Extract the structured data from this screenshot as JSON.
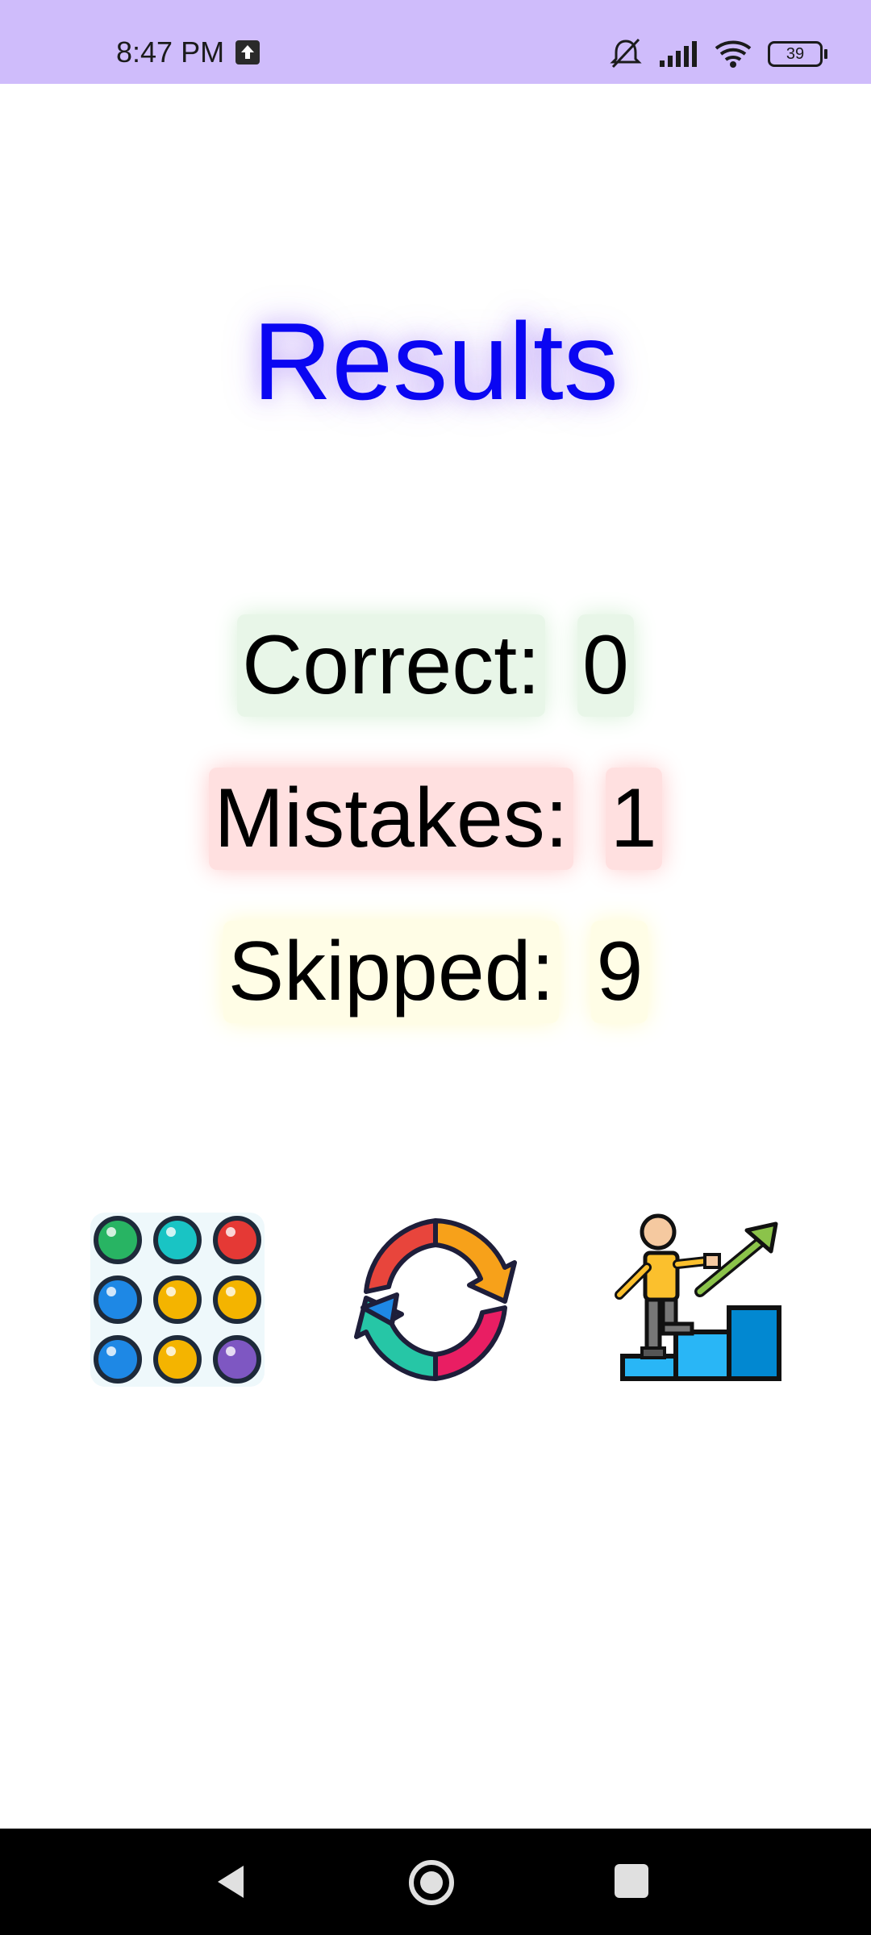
{
  "status_bar": {
    "time": "8:47 PM",
    "battery": "39",
    "icons": [
      "upload-icon",
      "mute-icon",
      "signal-icon",
      "wifi-icon",
      "battery-icon"
    ]
  },
  "title": "Results",
  "stats": {
    "correct": {
      "label": "Correct:",
      "value": "0"
    },
    "mistakes": {
      "label": "Mistakes:",
      "value": "1"
    },
    "skipped": {
      "label": "Skipped:",
      "value": "9"
    }
  },
  "actions": [
    "game-grid-icon",
    "restart-icon",
    "progress-icon"
  ],
  "nav": [
    "back-icon",
    "home-icon",
    "recents-icon"
  ],
  "colors": {
    "status_bar": "#cfbcfb",
    "title": "#0a06f2",
    "correct_bg": "#e8f6e8",
    "mistakes_bg": "#ffe0e0",
    "skipped_bg": "#fffde6"
  }
}
